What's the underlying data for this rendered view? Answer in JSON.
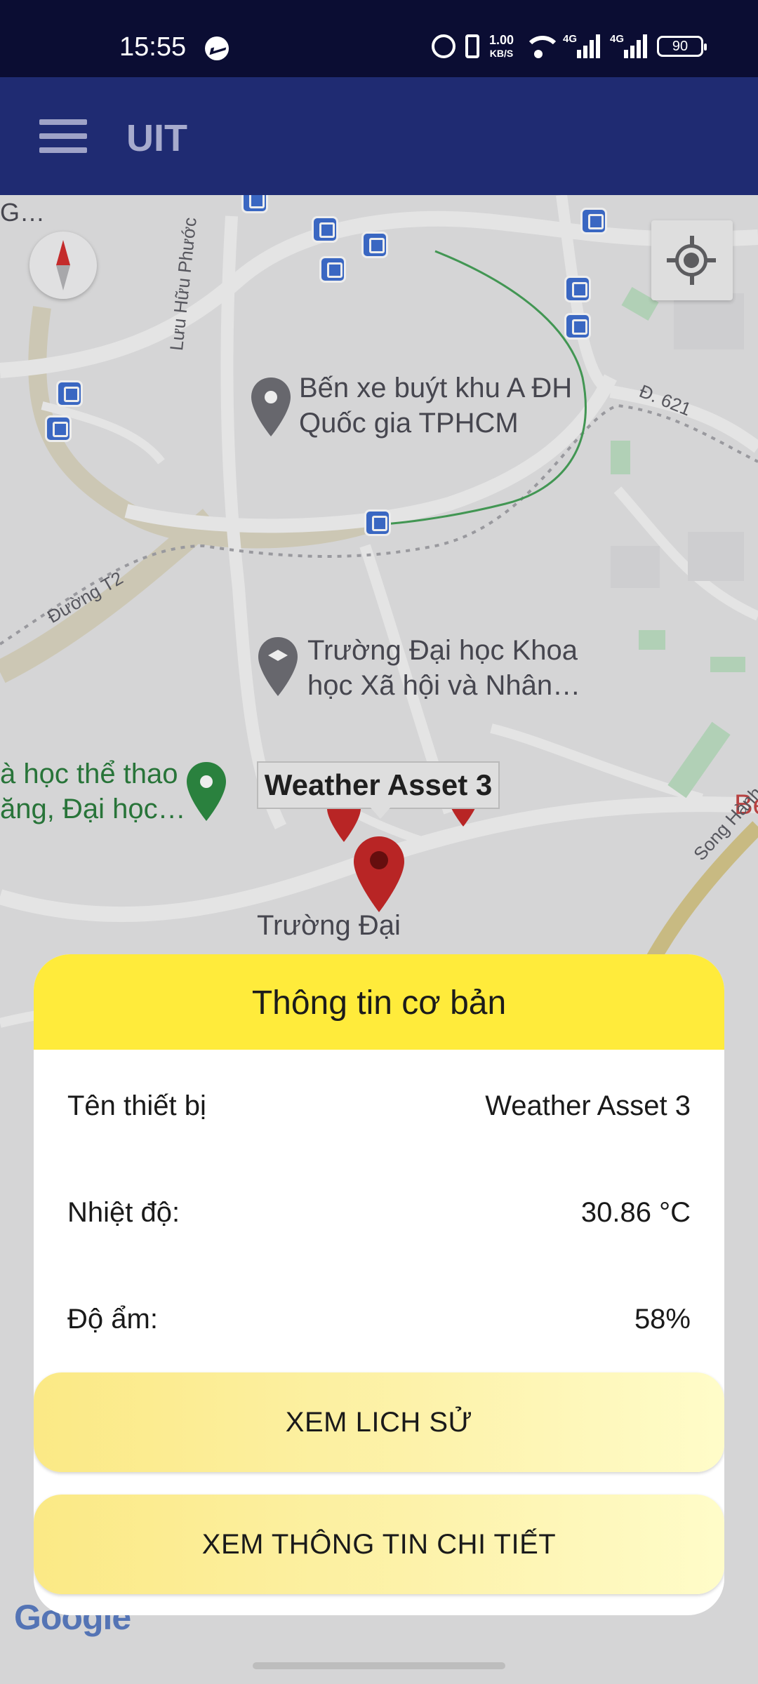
{
  "status_bar": {
    "time": "15:55",
    "net_speed_value": "1.00",
    "net_speed_unit": "KB/S",
    "sim1_label": "4G",
    "sim2_label": "4G",
    "battery": "90"
  },
  "app_bar": {
    "title": "UIT"
  },
  "map": {
    "poi_bus_station": "Bến xe buýt khu A ĐH\nQuốc gia TPHCM",
    "poi_university": "Trường Đại học Khoa\nhọc Xã hội và Nhân…",
    "poi_sports": "à học thể thao\năng, Đại học…",
    "poi_school_partial": "Trường Đại",
    "street_luu_huu_phuoc": "Lưu Hữu Phước",
    "street_duong_t2": "Đường T2",
    "street_d621": "Đ. 621",
    "street_song_hanh": "Song Hành",
    "edge_label_g": "G…",
    "edge_label_be": "Be",
    "marker_tooltip": "Weather Asset 3",
    "google_logo": "Google"
  },
  "sheet": {
    "title": "Thông tin cơ bản",
    "rows": [
      {
        "label": "Tên thiết bị",
        "value": "Weather Asset 3"
      },
      {
        "label": "Nhiệt độ:",
        "value": "30.86 °C"
      },
      {
        "label": "Độ ẩm:",
        "value": "58%"
      }
    ],
    "history_button": "XEM LICH SỬ",
    "detail_button": "XEM THÔNG TIN CHI TIẾT"
  },
  "colors": {
    "status_bar_bg": "#0b0d33",
    "app_bar_bg": "#1f2b72",
    "sheet_header_bg": "#ffeb3b",
    "marker_red": "#d32f2f",
    "poi_green": "#2e7d32"
  }
}
